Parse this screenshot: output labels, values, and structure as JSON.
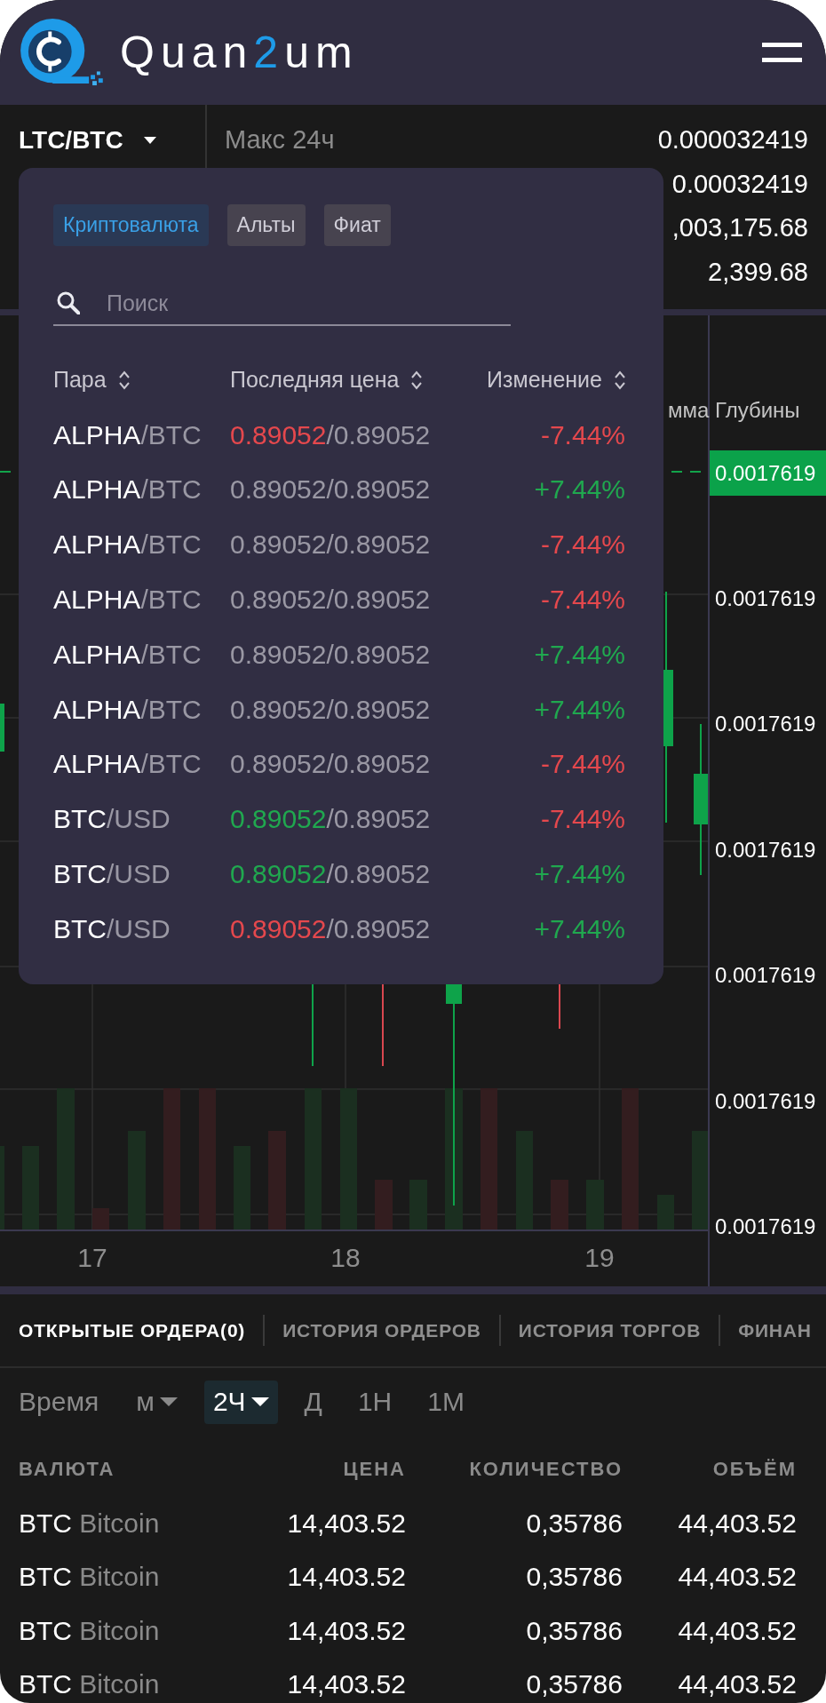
{
  "header": {
    "brand": [
      {
        "text": "Quan",
        "accent": false
      },
      {
        "text": "2",
        "accent": true
      },
      {
        "text": "um",
        "accent": false
      }
    ]
  },
  "ticker": {
    "pair": "LTC/BTC",
    "stats": [
      {
        "label": "Макс 24ч",
        "value": "0.000032419"
      },
      {
        "value": "0.00032419"
      },
      {
        "value": ",003,175.68"
      },
      {
        "value": "2,399.68"
      }
    ]
  },
  "pair_picker": {
    "categories": [
      {
        "label": "Криптовалюта",
        "selected": true
      },
      {
        "label": "Альты",
        "selected": false
      },
      {
        "label": "Фиат",
        "selected": false
      }
    ],
    "search": {
      "placeholder": "Поиск"
    },
    "columns": [
      "Пара",
      "Последняя цена",
      "Изменение"
    ],
    "rows": [
      {
        "base": "ALPHA",
        "quote": "/BTC",
        "last": {
          "text": "0.89052",
          "color": "#e5484d"
        },
        "ref": "/0.89052",
        "change": {
          "text": "-7.44%",
          "color": "#e5484d"
        }
      },
      {
        "base": "ALPHA",
        "quote": "/BTC",
        "last": {
          "text": "0.89052",
          "color": "#9a98a4"
        },
        "ref": "/0.89052",
        "change": {
          "text": "+7.44%",
          "color": "#20a84f"
        }
      },
      {
        "base": "ALPHA",
        "quote": "/BTC",
        "last": {
          "text": "0.89052",
          "color": "#9a98a4"
        },
        "ref": "/0.89052",
        "change": {
          "text": "-7.44%",
          "color": "#e5484d"
        }
      },
      {
        "base": "ALPHA",
        "quote": "/BTC",
        "last": {
          "text": "0.89052",
          "color": "#9a98a4"
        },
        "ref": "/0.89052",
        "change": {
          "text": "-7.44%",
          "color": "#e5484d"
        }
      },
      {
        "base": "ALPHA",
        "quote": "/BTC",
        "last": {
          "text": "0.89052",
          "color": "#9a98a4"
        },
        "ref": "/0.89052",
        "change": {
          "text": "+7.44%",
          "color": "#20a84f"
        }
      },
      {
        "base": "ALPHA",
        "quote": "/BTC",
        "last": {
          "text": "0.89052",
          "color": "#9a98a4"
        },
        "ref": "/0.89052",
        "change": {
          "text": "+7.44%",
          "color": "#20a84f"
        }
      },
      {
        "base": "ALPHA",
        "quote": "/BTC",
        "last": {
          "text": "0.89052",
          "color": "#9a98a4"
        },
        "ref": "/0.89052",
        "change": {
          "text": "-7.44%",
          "color": "#e5484d"
        }
      },
      {
        "base": "BTC",
        "quote": "/USD",
        "last": {
          "text": "0.89052",
          "color": "#20a84f"
        },
        "ref": "/0.89052",
        "change": {
          "text": "-7.44%",
          "color": "#e5484d"
        }
      },
      {
        "base": "BTC",
        "quote": "/USD",
        "last": {
          "text": "0.89052",
          "color": "#20a84f"
        },
        "ref": "/0.89052",
        "change": {
          "text": "+7.44%",
          "color": "#20a84f"
        }
      },
      {
        "base": "BTC",
        "quote": "/USD",
        "last": {
          "text": "0.89052",
          "color": "#e5484d"
        },
        "ref": "/0.89052",
        "change": {
          "text": "+7.44%",
          "color": "#20a84f"
        }
      }
    ]
  },
  "chart": {
    "legend": "мма Глубины",
    "current_price": "0.0017619",
    "price_labels": [
      "0.0017619",
      "0.0017619",
      "0.0017619",
      "0.0017619",
      "0.0017619",
      "0.0017619"
    ],
    "x_labels": [
      "17",
      "18",
      "19"
    ]
  },
  "orders": {
    "tabs": [
      {
        "label": "ОТКРЫТЫЕ ОРДЕРА(0)",
        "selected": true
      },
      {
        "label": "ИСТОРИЯ ОРДЕРОВ",
        "selected": false
      },
      {
        "label": "ИСТОРИЯ ТОРГОВ",
        "selected": false
      },
      {
        "label": "ФИНАН",
        "selected": false
      }
    ],
    "time_label": "Время",
    "intervals": [
      {
        "label": "м",
        "dropdown": true,
        "selected": false
      },
      {
        "label": "2Ч",
        "dropdown": true,
        "selected": true
      },
      {
        "label": "Д",
        "dropdown": false,
        "selected": false
      },
      {
        "label": "1Н",
        "dropdown": false,
        "selected": false
      },
      {
        "label": "1М",
        "dropdown": false,
        "selected": false
      }
    ],
    "table": {
      "columns": [
        "ВАЛЮТА",
        "ЦЕНА",
        "КОЛИЧЕСТВО",
        "ОБЪЁМ"
      ],
      "rows": [
        {
          "code": "BTC",
          "name": "Bitcoin",
          "price": "14,403.52",
          "amount": "0,35786",
          "volume": "44,403.52"
        },
        {
          "code": "BTC",
          "name": "Bitcoin",
          "price": "14,403.52",
          "amount": "0,35786",
          "volume": "44,403.52"
        },
        {
          "code": "BTC",
          "name": "Bitcoin",
          "price": "14,403.52",
          "amount": "0,35786",
          "volume": "44,403.52"
        },
        {
          "code": "BTC",
          "name": "Bitcoin",
          "price": "14,403.52",
          "amount": "0,35786",
          "volume": "44,403.52"
        }
      ]
    }
  }
}
